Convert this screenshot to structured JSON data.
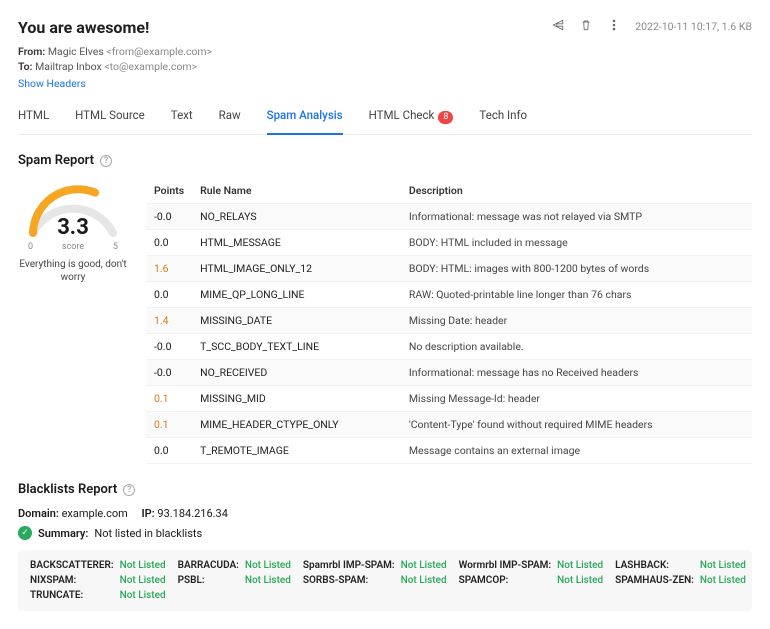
{
  "header": {
    "title": "You are awesome!",
    "timestamp": "2022-10-11 10:17, 1.6 KB",
    "from_label": "From:",
    "from_name": "Magic Elves",
    "from_addr": "<from@example.com>",
    "to_label": "To:",
    "to_name": "Mailtrap Inbox",
    "to_addr": "<to@example.com>",
    "show_headers": "Show Headers"
  },
  "tabs": [
    {
      "label": "HTML"
    },
    {
      "label": "HTML Source"
    },
    {
      "label": "Text"
    },
    {
      "label": "Raw"
    },
    {
      "label": "Spam Analysis",
      "active": true
    },
    {
      "label": "HTML Check",
      "badge": "8"
    },
    {
      "label": "Tech Info"
    }
  ],
  "sections": {
    "spam_title": "Spam Report",
    "blacklist_title": "Blacklists Report"
  },
  "score": {
    "value": "3.3",
    "scale_min": "0",
    "scale_label": "score",
    "scale_max": "5",
    "message": "Everything is good, don't worry"
  },
  "table": {
    "headers": {
      "points": "Points",
      "rule": "Rule Name",
      "desc": "Description"
    },
    "rows": [
      {
        "points": "-0.0",
        "warn": false,
        "rule": "NO_RELAYS",
        "desc": "Informational: message was not relayed via SMTP"
      },
      {
        "points": "0.0",
        "warn": false,
        "rule": "HTML_MESSAGE",
        "desc": "BODY: HTML included in message"
      },
      {
        "points": "1.6",
        "warn": true,
        "rule": "HTML_IMAGE_ONLY_12",
        "desc": "BODY: HTML: images with 800-1200 bytes of words"
      },
      {
        "points": "0.0",
        "warn": false,
        "rule": "MIME_QP_LONG_LINE",
        "desc": "RAW: Quoted-printable line longer than 76 chars"
      },
      {
        "points": "1.4",
        "warn": true,
        "rule": "MISSING_DATE",
        "desc": "Missing Date: header"
      },
      {
        "points": "-0.0",
        "warn": false,
        "rule": "T_SCC_BODY_TEXT_LINE",
        "desc": "No description available."
      },
      {
        "points": "-0.0",
        "warn": false,
        "rule": "NO_RECEIVED",
        "desc": "Informational: message has no Received headers"
      },
      {
        "points": "0.1",
        "warn": true,
        "rule": "MISSING_MID",
        "desc": "Missing Message-Id: header"
      },
      {
        "points": "0.1",
        "warn": true,
        "rule": "MIME_HEADER_CTYPE_ONLY",
        "desc": "'Content-Type' found without required MIME headers"
      },
      {
        "points": "0.0",
        "warn": false,
        "rule": "T_REMOTE_IMAGE",
        "desc": "Message contains an external image"
      }
    ]
  },
  "blacklists": {
    "domain_label": "Domain:",
    "domain_value": "example.com",
    "ip_label": "IP:",
    "ip_value": "93.184.216.34",
    "summary_label": "Summary:",
    "summary_value": "Not listed in blacklists",
    "status_not_listed": "Not Listed",
    "items": [
      [
        {
          "name": "BACKSCATTERER:"
        },
        {
          "name": "BARRACUDA:"
        },
        {
          "name": "Spamrbl IMP-SPAM:"
        },
        {
          "name": "Wormrbl IMP-SPAM:"
        },
        {
          "name": "LASHBACK:"
        }
      ],
      [
        {
          "name": "NIXSPAM:"
        },
        {
          "name": "PSBL:"
        },
        {
          "name": "SORBS-SPAM:"
        },
        {
          "name": "SPAMCOP:"
        },
        {
          "name": "SPAMHAUS-ZEN:"
        }
      ],
      [
        {
          "name": "TRUNCATE:"
        }
      ]
    ]
  }
}
